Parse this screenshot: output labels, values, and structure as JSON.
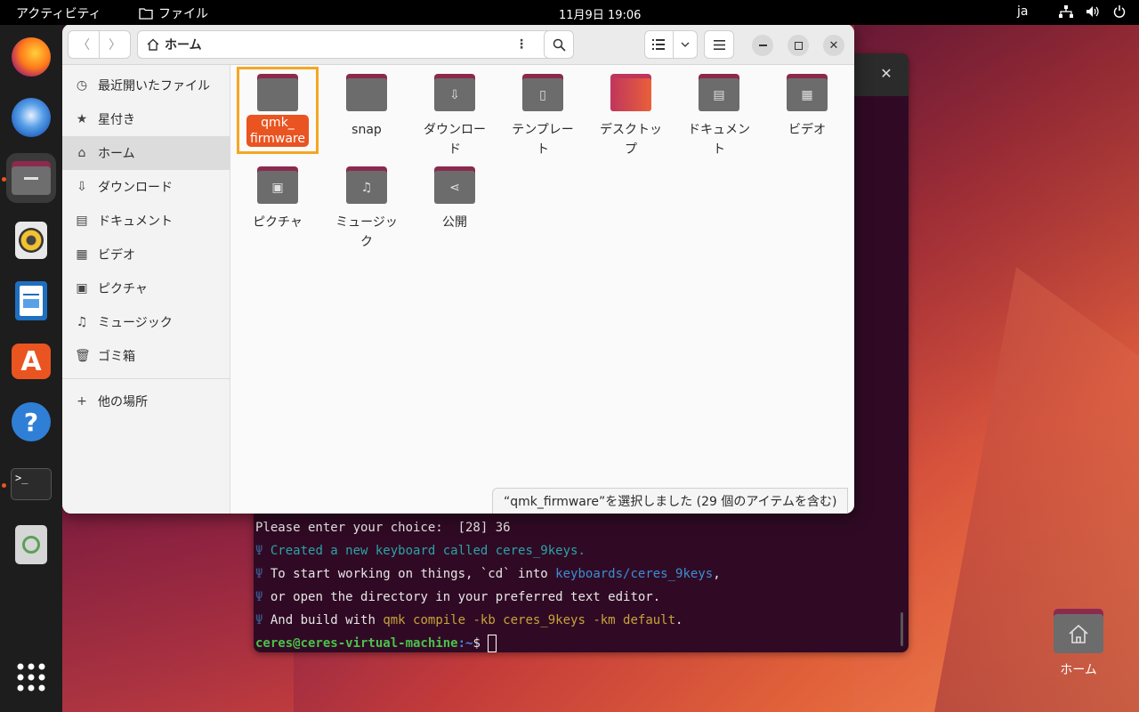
{
  "topbar": {
    "activities": "アクティビティ",
    "app_menu": "ファイル",
    "clock": "11月9日  19:06",
    "lang": "ja"
  },
  "dock": {
    "apps": [
      "firefox-icon",
      "thunderbird-icon",
      "files-icon",
      "rhythmbox-icon",
      "writer-icon",
      "app-center-icon",
      "help-icon",
      "terminal-icon",
      "trash-icon",
      "show-apps-icon"
    ]
  },
  "files": {
    "path": "ホーム",
    "sidebar": [
      {
        "label": "最近開いたファイル",
        "icon": "clock-icon"
      },
      {
        "label": "星付き",
        "icon": "star-icon"
      },
      {
        "label": "ホーム",
        "icon": "home-icon"
      },
      {
        "label": "ダウンロード",
        "icon": "download-icon"
      },
      {
        "label": "ドキュメント",
        "icon": "document-icon"
      },
      {
        "label": "ビデオ",
        "icon": "video-icon"
      },
      {
        "label": "ピクチャ",
        "icon": "picture-icon"
      },
      {
        "label": "ミュージック",
        "icon": "music-icon"
      },
      {
        "label": "ゴミ箱",
        "icon": "trash-icon"
      }
    ],
    "other_places": "他の場所",
    "items": [
      {
        "line1": "qmk_",
        "line2": "firmware"
      },
      {
        "line1": "snap",
        "line2": ""
      },
      {
        "line1": "ダウンロー",
        "line2": "ド"
      },
      {
        "line1": "テンプレー",
        "line2": "ト"
      },
      {
        "line1": "デスクトッ",
        "line2": "プ"
      },
      {
        "line1": "ドキュメン",
        "line2": "ト"
      },
      {
        "line1": "ビデオ",
        "line2": ""
      },
      {
        "line1": "ピクチャ",
        "line2": ""
      },
      {
        "line1": "ミュージッ",
        "line2": "ク"
      },
      {
        "line1": "公開",
        "line2": ""
      }
    ],
    "status": "“qmk_firmware”を選択しました (29 個のアイテムを含む)"
  },
  "terminal": {
    "line0": "Please enter your choice:  [28] 36",
    "psi": "Ψ",
    "line1": "Created a new keyboard called ceres_9keys.",
    "line2a": "To start working on things, `cd` into ",
    "line2b": "keyboards/ceres_9keys",
    "line2c": ",",
    "line3": "or open the directory in your preferred text editor.",
    "line4a": "And build with ",
    "line4b": "qmk compile -kb ceres_9keys -km default",
    "line4c": ".",
    "prompt_user": "ceres@ceres-virtual-machine",
    "prompt_path": ":~",
    "prompt_sign": "$ "
  },
  "desktop": {
    "home_label": "ホーム"
  }
}
